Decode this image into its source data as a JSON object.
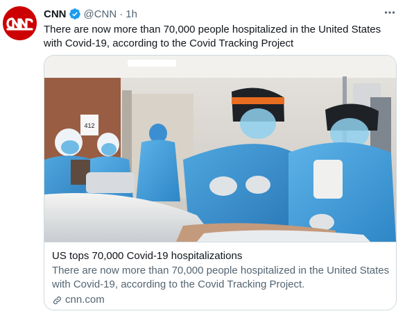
{
  "tweet": {
    "author_name": "CNN",
    "author_handle": "@CNN",
    "separator": "·",
    "timestamp": "1h",
    "text": "There are now more than 70,000 people hospitalized in the United States with Covid-19, according to the Covid Tracking Project",
    "avatar_logo_text": "CNN",
    "icons": {
      "verified": "verified-badge-icon",
      "more": "more-options-icon",
      "link": "link-icon"
    },
    "colors": {
      "avatar_bg": "#cc0000",
      "verified": "#1d9bf0",
      "secondary_text": "#536471",
      "border": "#cfd9de"
    }
  },
  "card": {
    "title": "US tops 70,000 Covid-19 hospitalizations",
    "description": "There are now more than 70,000 people hospitalized in the United States with Covid-19, according to the Covid Tracking Project.",
    "domain": "cnn.com",
    "image_subject": "medical-staff-in-protective-gear-photo",
    "room_sign": "412"
  }
}
